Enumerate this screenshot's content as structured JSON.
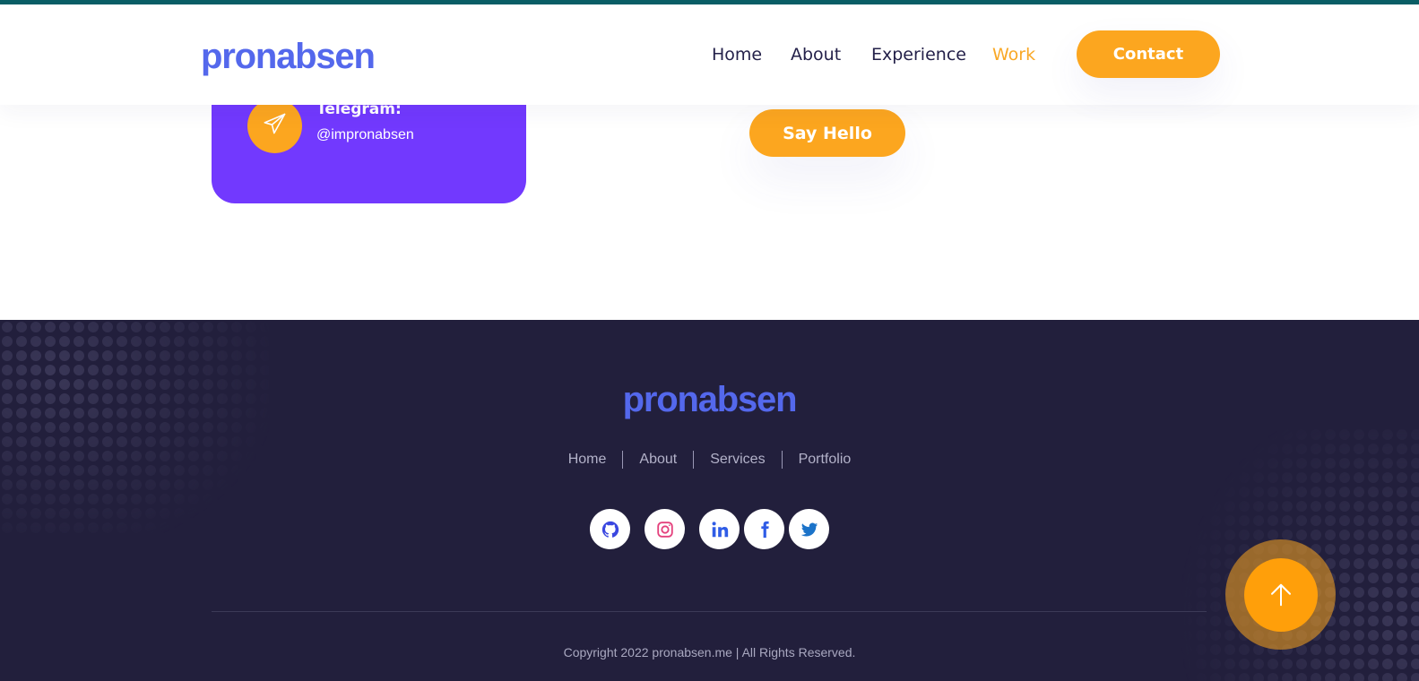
{
  "header": {
    "logo": "pronabsen",
    "nav": [
      {
        "label": "Home",
        "active": false
      },
      {
        "label": "About",
        "active": false
      },
      {
        "label": "Experience",
        "active": false
      },
      {
        "label": "Work",
        "active": true
      }
    ],
    "contact_label": "Contact"
  },
  "contact_card": {
    "telegram_label": "Telegram:",
    "telegram_value": "@impronabsen",
    "icon": "paper-plane-icon"
  },
  "say_hello_label": "Say Hello",
  "footer": {
    "logo": "pronabsen",
    "links": [
      "Home",
      "About",
      "Services",
      "Portfolio"
    ],
    "social": [
      {
        "name": "github-icon",
        "color": "#3a47e0"
      },
      {
        "name": "instagram-icon",
        "color": "#e4407c"
      },
      {
        "name": "linkedin-icon",
        "color": "#2f5ce6"
      },
      {
        "name": "facebook-icon",
        "color": "#2f5ce6"
      },
      {
        "name": "twitter-icon",
        "color": "#1b73c9"
      }
    ],
    "copyright": "Copyright 2022 pronabsen.me | All Rights Reserved."
  },
  "scroll_top_icon": "arrow-up-icon",
  "colors": {
    "brand": "#5468ec",
    "accent": "#fca61f",
    "card": "#7239fe",
    "footer_bg": "#221f3c",
    "top_strip": "#0b5f66"
  }
}
